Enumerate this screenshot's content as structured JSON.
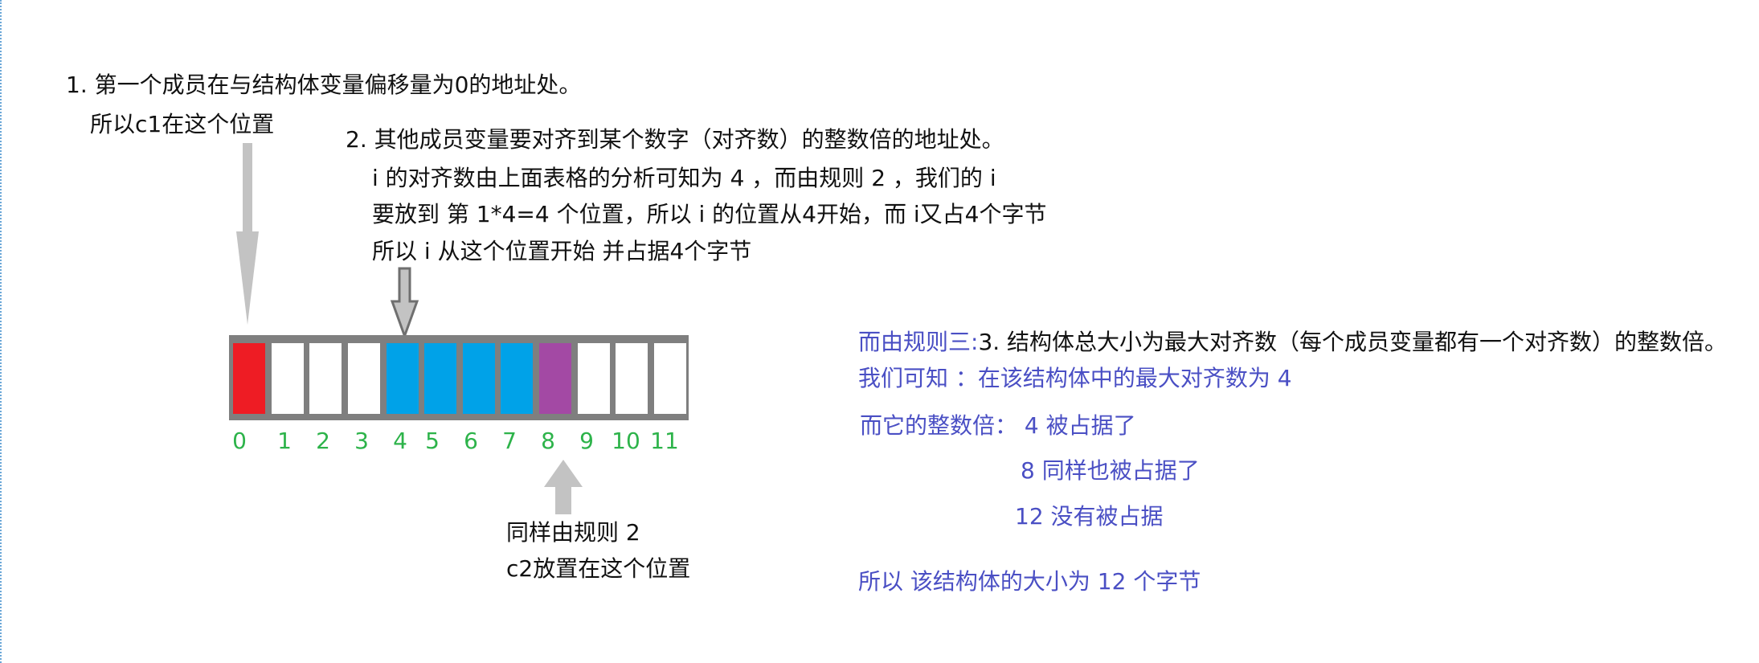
{
  "rule1": {
    "line1": "1. 第一个成员在与结构体变量偏移量为0的地址处。",
    "line2": "所以c1在这个位置"
  },
  "rule2": {
    "line1": "2. 其他成员变量要对齐到某个数字（对齐数）的整数倍的地址处。",
    "line2": "i 的对齐数由上面表格的分析可知为 4 ，而由规则 2 ，我们的 i",
    "line3": "要放到 第 1*4=4 个位置，所以 i 的位置从4开始，而 i又占4个字节",
    "line4": "所以 i 从这个位置开始 并占据4个字节"
  },
  "c2_note": {
    "line1": "同样由规则 2",
    "line2": "c2放置在这个位置"
  },
  "rule3": {
    "prefix": "而由规则三:",
    "text": "3. 结构体总大小为最大对齐数（每个成员变量都有一个对齐数）的整数倍。",
    "line2": "我们可知 ：在该结构体中的最大对齐数为 4",
    "line3": "而它的整数倍：  4  被占据了",
    "line4": "8 同样也被占据了",
    "line5": "12 没有被占据",
    "conclusion": "所以 该结构体的大小为 12 个字节"
  },
  "memory": {
    "indices": [
      "0",
      "1",
      "2",
      "3",
      "4",
      "5",
      "6",
      "7",
      "8",
      "9",
      "10",
      "11"
    ],
    "cells": [
      "c1",
      "empty",
      "empty",
      "empty",
      "i",
      "i",
      "i",
      "i",
      "c2",
      "empty",
      "empty",
      "empty"
    ],
    "colors": {
      "c1": "#ee1c24",
      "i": "#00a2e8",
      "c2": "#a349a4",
      "empty": "#ffffff",
      "border": "#7f7f7f",
      "index_text": "#2db34a",
      "arrow": "#c3c3c3",
      "note_blue": "#4a4fc4"
    }
  }
}
